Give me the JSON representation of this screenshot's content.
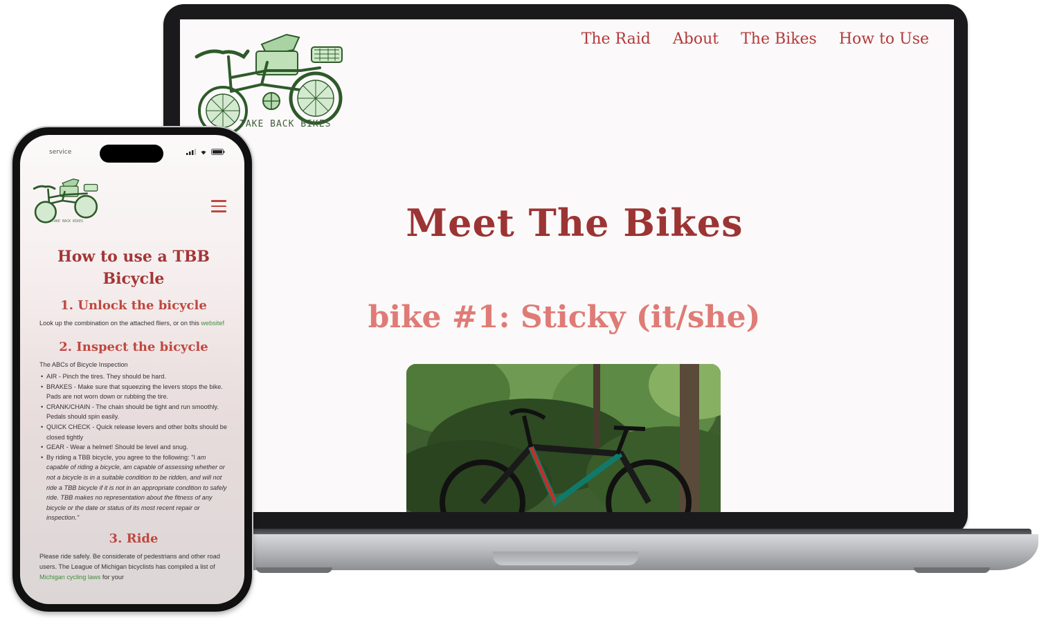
{
  "laptop": {
    "logo_caption": "TAKE BACK BIKES",
    "nav": [
      {
        "label": "The Raid"
      },
      {
        "label": "About"
      },
      {
        "label": "The Bikes"
      },
      {
        "label": "How to Use"
      }
    ],
    "page_title": "Meet The Bikes",
    "bike_heading": "bike #1: Sticky (it/she)"
  },
  "phone": {
    "carrier": "service",
    "logo_caption": "TAKE BACK BIKES",
    "title": "How to use a TBB Bicycle",
    "step1": {
      "heading": "1. Unlock the bicycle",
      "text": "Look up the combination on the attached fliers, or on this",
      "link": "website",
      "after_link": "!"
    },
    "step2": {
      "heading": "2. Inspect the bicycle",
      "intro": "The ABCs of Bicycle Inspection",
      "items": [
        "AIR - Pinch the tires. They should be hard.",
        "BRAKES - Make sure that squeezing the levers stops the bike. Pads are not worn down or rubbing the tire.",
        "CRANK/CHAIN - The chain should be tight and run smoothly. Pedals should spin easily.",
        "QUICK CHECK - Quick release levers and other bolts should be closed tightly",
        "GEAR - Wear a helmet! Should be level and snug."
      ],
      "agreement_lead": "By riding a TBB bicycle, you agree to the following: \"I",
      "agreement_italic": "am capable of riding a bicycle, am capable of assessing whether or not a bicycle is in a suitable condition to be ridden, and will not ride a TBB bicycle if it is not in an appropriate condition to safely ride. TBB makes no representation about the fitness of any bicycle or the date or status of its most recent repair or inspection.\""
    },
    "step3": {
      "heading": "3. Ride",
      "text": "Please ride safely. Be considerate of pedestrians and other road users. The League of Michigan bicyclists has compiled a list of",
      "link": "Michigan cycling laws",
      "after_link": "for your"
    }
  }
}
